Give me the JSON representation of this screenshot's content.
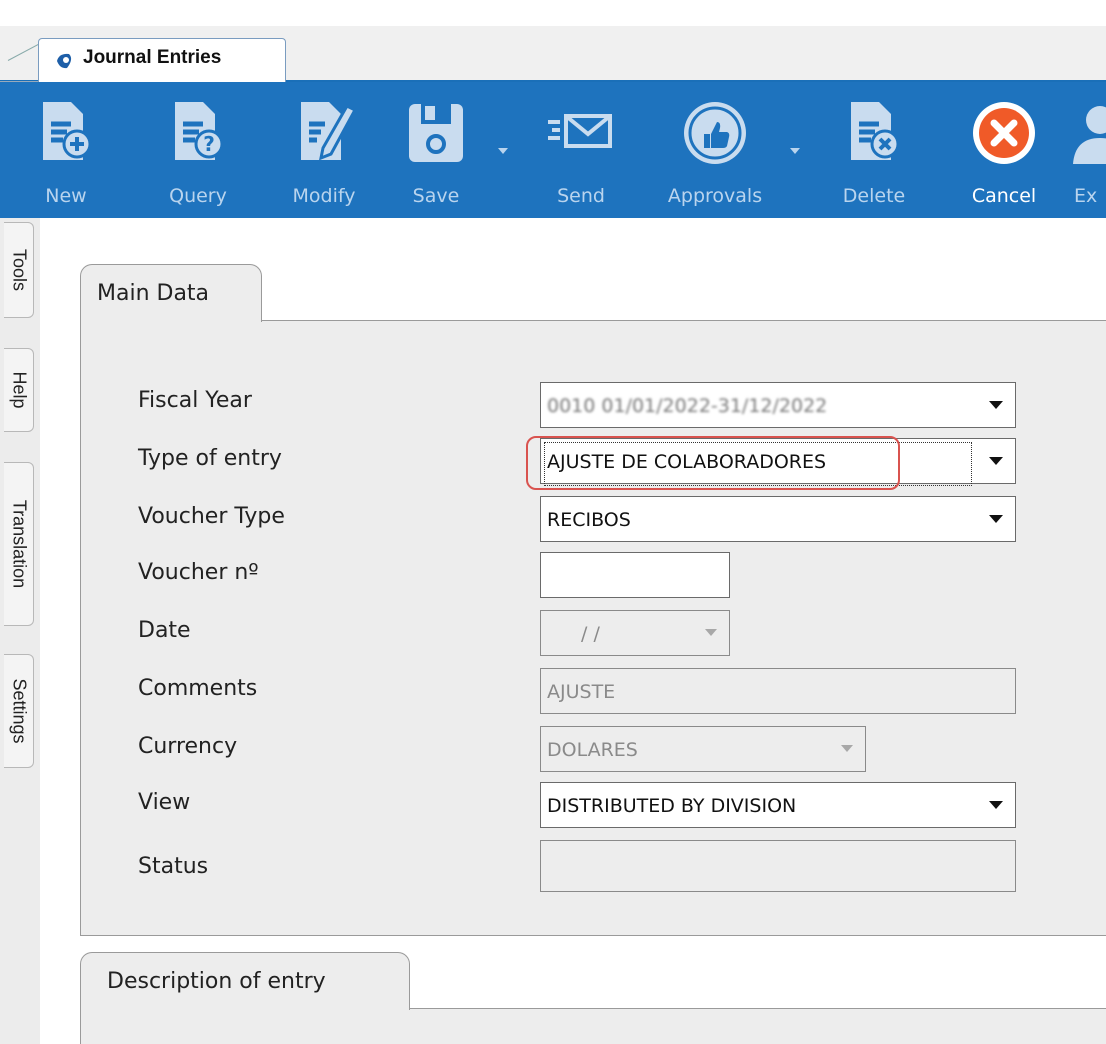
{
  "window": {
    "tab_title": "Journal Entries"
  },
  "toolbar": {
    "buttons": [
      {
        "label": "New",
        "icon": "doc-plus-icon"
      },
      {
        "label": "Query",
        "icon": "doc-question-icon"
      },
      {
        "label": "Modify",
        "icon": "doc-pencil-icon"
      },
      {
        "label": "Save",
        "icon": "floppy-icon"
      },
      {
        "label": "Send",
        "icon": "envelope-icon"
      },
      {
        "label": "Approvals",
        "icon": "thumbs-up-icon"
      },
      {
        "label": "Delete",
        "icon": "doc-delete-icon"
      },
      {
        "label": "Cancel",
        "icon": "cancel-x-icon"
      },
      {
        "label": "Ex",
        "icon": "user-icon"
      }
    ]
  },
  "side_tabs": [
    "Tools",
    "Help",
    "Translation",
    "Settings"
  ],
  "main_data": {
    "tab_label": "Main Data",
    "fields": {
      "fiscal_year": {
        "label": "Fiscal Year",
        "value": "0010 01/01/2022-31/12/2022"
      },
      "type_of_entry": {
        "label": "Type of entry",
        "value": "AJUSTE DE COLABORADORES"
      },
      "voucher_type": {
        "label": "Voucher Type",
        "value": "RECIBOS"
      },
      "voucher_no": {
        "label": "Voucher nº",
        "value": ""
      },
      "date": {
        "label": "Date",
        "value": "  /  /"
      },
      "comments": {
        "label": "Comments",
        "value": "AJUSTE"
      },
      "currency": {
        "label": "Currency",
        "value": "DOLARES"
      },
      "view": {
        "label": "View",
        "value": "DISTRIBUTED BY DIVISION"
      },
      "status": {
        "label": "Status",
        "value": ""
      }
    }
  },
  "description": {
    "tab_label": "Description of entry"
  },
  "colors": {
    "toolbar_bg": "#1e73be",
    "highlight": "#d9534f",
    "panel_bg": "#ededed"
  }
}
